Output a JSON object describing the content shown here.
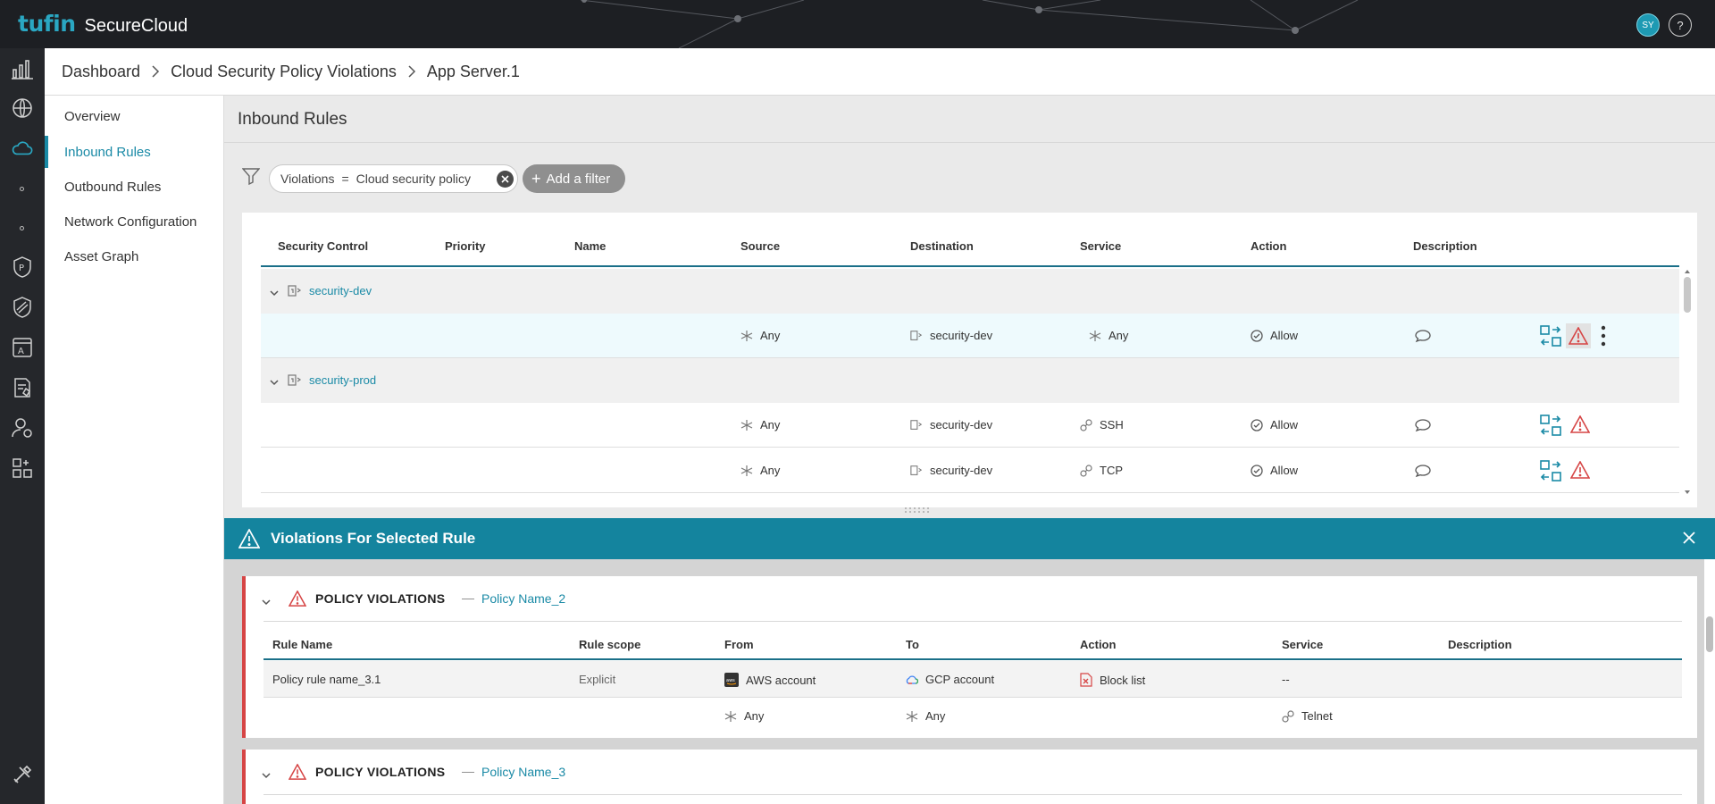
{
  "app": {
    "brand": "tufin",
    "product": "SecureCloud"
  },
  "user": {
    "initials": "SY",
    "help_label": "?"
  },
  "breadcrumb": [
    "Dashboard",
    "Cloud Security Policy Violations",
    "App Server.1"
  ],
  "subnav": {
    "items": [
      {
        "label": "Overview",
        "active": false
      },
      {
        "label": "Inbound Rules",
        "active": true
      },
      {
        "label": "Outbound Rules",
        "active": false
      },
      {
        "label": "Network Configuration",
        "active": false
      },
      {
        "label": "Asset Graph",
        "active": false
      }
    ]
  },
  "page": {
    "title": "Inbound Rules"
  },
  "filter": {
    "field": "Violations",
    "operator": "=",
    "value": "Cloud security policy",
    "add_label": "Add a filter"
  },
  "rules_table": {
    "columns": [
      "Security Control",
      "Priority",
      "Name",
      "Source",
      "Destination",
      "Service",
      "Action",
      "Description"
    ],
    "groups": [
      {
        "name": "security-dev",
        "rows": [
          {
            "source": "Any",
            "destination": "security-dev",
            "service": "Any",
            "action": "Allow",
            "selected": true
          }
        ]
      },
      {
        "name": "security-prod",
        "rows": [
          {
            "source": "Any",
            "destination": "security-dev",
            "service": "SSH",
            "action": "Allow",
            "selected": false
          },
          {
            "source": "Any",
            "destination": "security-dev",
            "service": "TCP",
            "action": "Allow",
            "selected": false
          }
        ]
      }
    ]
  },
  "violations_panel": {
    "title": "Violations For Selected Rule",
    "section_label": "POLICY  VIOLATIONS",
    "separator": "—",
    "columns": [
      "Rule Name",
      "Rule scope",
      "From",
      "To",
      "Action",
      "Service",
      "Description"
    ],
    "policies": [
      {
        "name": "Policy Name_2",
        "rows": [
          {
            "rule_name": "Policy rule name_3.1",
            "scope": "Explicit",
            "from": "AWS account",
            "to": "GCP account",
            "action": "Block list",
            "service": "--"
          },
          {
            "rule_name": "",
            "scope": "",
            "from": "Any",
            "to": "Any",
            "action": "",
            "service": "Telnet"
          }
        ]
      },
      {
        "name": "Policy Name_3",
        "rows": []
      }
    ]
  },
  "colors": {
    "accent": "#1a8aa6",
    "topbar": "#1d1f23",
    "rail": "#25272b",
    "panel_header": "#14849e",
    "violation_red": "#d64545"
  }
}
